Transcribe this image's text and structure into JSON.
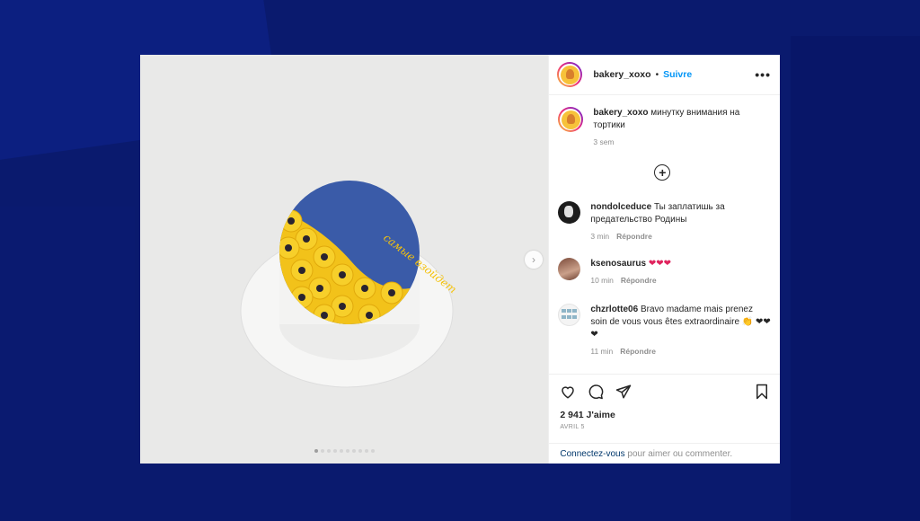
{
  "post": {
    "username": "bakery_xoxo",
    "separator": "•",
    "follow_label": "Suivre",
    "more_label": "•••",
    "caption_text": "минутку внимания на тортики",
    "caption_time": "3 sem",
    "cake_text": "самые взойдет",
    "load_more_label": "+"
  },
  "comments": [
    {
      "username": "nondolceduce",
      "text": "Ты заплатишь за предательство Родины",
      "time": "3 min",
      "reply": "Répondre"
    },
    {
      "username": "ksenosaurus",
      "text": "❤❤❤",
      "time": "10 min",
      "reply": "Répondre"
    },
    {
      "username": "chzrlotte06",
      "text": "Bravo madame mais prenez soin de vous vous êtes extraordinaire 👏 ❤❤❤",
      "time": "11 min",
      "reply": "Répondre"
    }
  ],
  "footer": {
    "likes": "2 941 J'aime",
    "date": "AVRIL 5",
    "login_link": "Connectez-vous",
    "login_text": " pour aimer ou commenter."
  },
  "colors": {
    "accent": "#0095f6",
    "heart": "#e0245e",
    "cake_blue": "#3a5ba8",
    "sunflower": "#f4c20d"
  }
}
